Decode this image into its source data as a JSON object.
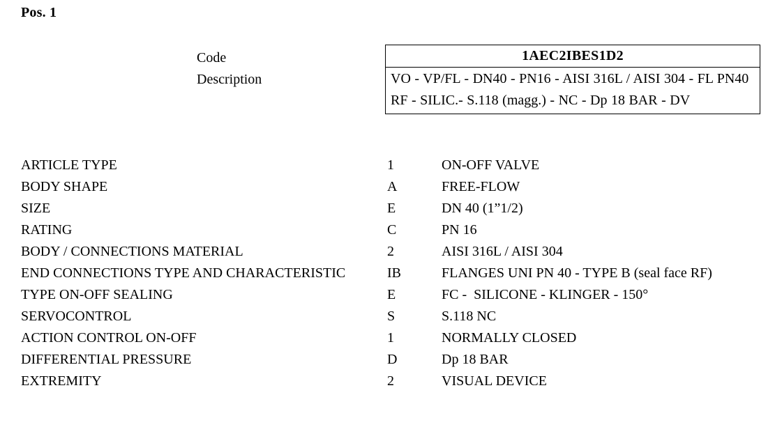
{
  "document": {
    "position_heading": "Pos. 1"
  },
  "summary": {
    "code_label": "Code",
    "description_label": "Description",
    "code_value": "1AEC2IBES1D2",
    "description_value": "VO - VP/FL - DN40 - PN16 - AISI 316L / AISI 304 - FL PN40 RF - SILIC.- S.118 (magg.) - NC - Dp 18 BAR - DV"
  },
  "specifications": {
    "rows": [
      {
        "label": "ARTICLE TYPE",
        "code": "1",
        "value": "ON-OFF VALVE"
      },
      {
        "label": "BODY SHAPE",
        "code": "A",
        "value": "FREE-FLOW"
      },
      {
        "label": "SIZE",
        "code": "E",
        "value": "DN 40 (1”1/2)"
      },
      {
        "label": "RATING",
        "code": "C",
        "value": "PN 16"
      },
      {
        "label": "BODY / CONNECTIONS MATERIAL",
        "code": "2",
        "value": "AISI 316L / AISI 304"
      },
      {
        "label": "END CONNECTIONS TYPE AND CHARACTERISTIC",
        "code": "IB",
        "value": "FLANGES UNI PN 40 - TYPE B (seal face RF)"
      },
      {
        "label": "TYPE ON-OFF SEALING",
        "code": "E",
        "value": "FC -  SILICONE - KLINGER - 150°"
      },
      {
        "label": "SERVOCONTROL",
        "code": "S",
        "value": "S.118 NC"
      },
      {
        "label": "ACTION CONTROL ON-OFF",
        "code": "1",
        "value": "NORMALLY CLOSED"
      },
      {
        "label": "DIFFERENTIAL PRESSURE",
        "code": "D",
        "value": "Dp 18 BAR"
      },
      {
        "label": "EXTREMITY",
        "code": "2",
        "value": "VISUAL DEVICE"
      }
    ]
  },
  "colors": {
    "text": "#000000",
    "background": "#ffffff",
    "border": "#000000"
  }
}
